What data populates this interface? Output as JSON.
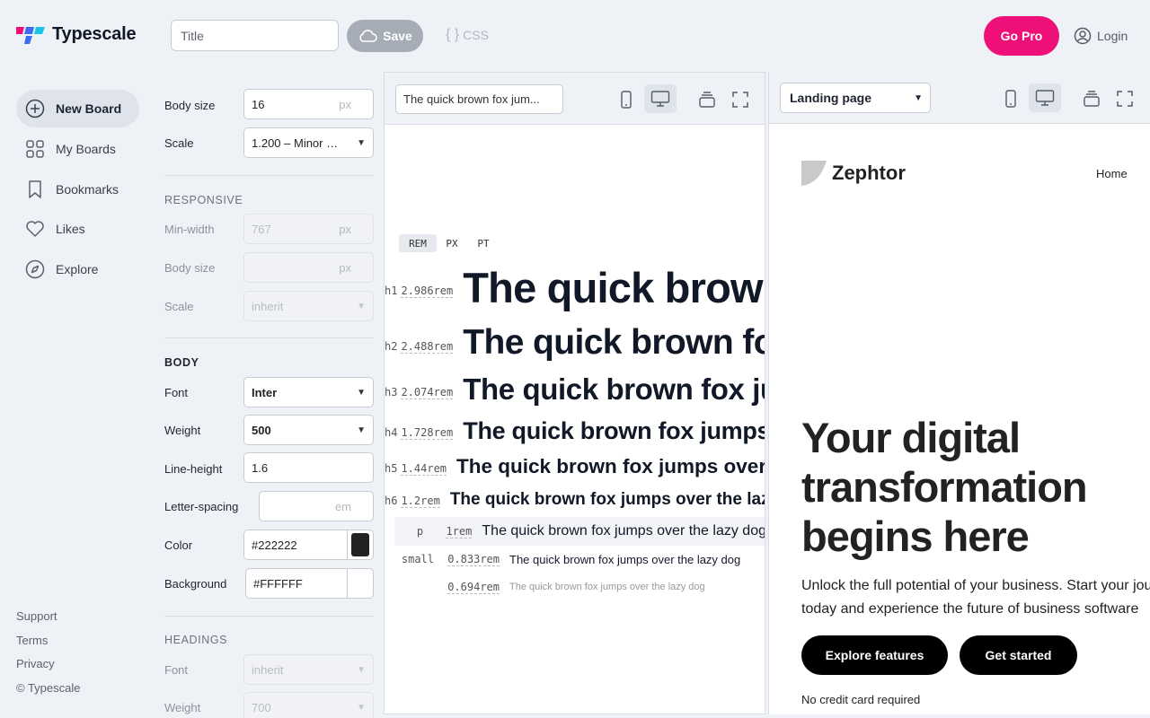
{
  "app": {
    "name": "Typescale"
  },
  "header": {
    "title_placeholder": "Title",
    "save_label": "Save",
    "css_label": "CSS",
    "gopro_label": "Go Pro",
    "login_label": "Login"
  },
  "sidebar": {
    "items": [
      {
        "label": "New Board",
        "icon": "plus-circle-icon"
      },
      {
        "label": "My Boards",
        "icon": "grid-icon"
      },
      {
        "label": "Bookmarks",
        "icon": "bookmark-icon"
      },
      {
        "label": "Likes",
        "icon": "heart-icon"
      },
      {
        "label": "Explore",
        "icon": "compass-icon"
      }
    ],
    "footer": [
      "Support",
      "Terms",
      "Privacy",
      "© Typescale"
    ]
  },
  "controls": {
    "body_size_label": "Body size",
    "body_size_value": "16",
    "unit_px": "px",
    "unit_em": "em",
    "scale_label": "Scale",
    "scale_value": "1.200 – Minor …",
    "responsive_heading": "RESPONSIVE",
    "min_width_label": "Min-width",
    "min_width_placeholder": "767",
    "resp_body_size_label": "Body size",
    "resp_scale_label": "Scale",
    "resp_scale_value": "inherit",
    "body_heading": "BODY",
    "font_label": "Font",
    "font_value": "Inter",
    "weight_label": "Weight",
    "weight_value": "500",
    "line_height_label": "Line-height",
    "line_height_value": "1.6",
    "letter_spacing_label": "Letter-spacing",
    "color_label": "Color",
    "color_value": "#222222",
    "background_label": "Background",
    "background_value": "#FFFFFF",
    "headings_heading": "HEADINGS",
    "h_font_label": "Font",
    "h_font_value": "inherit",
    "h_weight_label": "Weight",
    "h_weight_value": "700"
  },
  "preview": {
    "sample_text_input": "The quick brown fox jum...",
    "unit_tabs": [
      "REM",
      "PX",
      "PT"
    ],
    "rows": [
      {
        "tag": "h1",
        "size": "2.986rem",
        "text": "The quick brown fox jumps over the lazy dog"
      },
      {
        "tag": "h2",
        "size": "2.488rem",
        "text": "The quick brown fox jumps over the lazy dog"
      },
      {
        "tag": "h3",
        "size": "2.074rem",
        "text": "The quick brown fox jumps over the lazy dog"
      },
      {
        "tag": "h4",
        "size": "1.728rem",
        "text": "The quick brown fox jumps over the lazy dog"
      },
      {
        "tag": "h5",
        "size": "1.44rem",
        "text": "The quick brown fox jumps over the lazy dog"
      },
      {
        "tag": "h6",
        "size": "1.2rem",
        "text": "The quick brown fox jumps over the lazy dog"
      },
      {
        "tag": "p",
        "size": "1rem",
        "text": "The quick brown fox jumps over the lazy dog"
      },
      {
        "tag": "small",
        "size": "0.833rem",
        "text": "The quick brown fox jumps over the lazy dog"
      },
      {
        "tag": "",
        "size": "0.694rem",
        "text": "The quick brown fox jumps over the lazy dog"
      }
    ]
  },
  "landing": {
    "template_select": "Landing page",
    "brand": "Zephtor",
    "nav_home": "Home",
    "hero_title": "Your digital transformation begins here",
    "hero_text_1": "Unlock the full potential of your business. Start your journey",
    "hero_text_2": "today and experience the future of business software",
    "explore_btn": "Explore features",
    "started_btn": "Get started",
    "no_cc": "No credit card required"
  },
  "colors": {
    "accent_pink": "#ef0f78",
    "body_color": "#222222",
    "background": "#FFFFFF"
  }
}
